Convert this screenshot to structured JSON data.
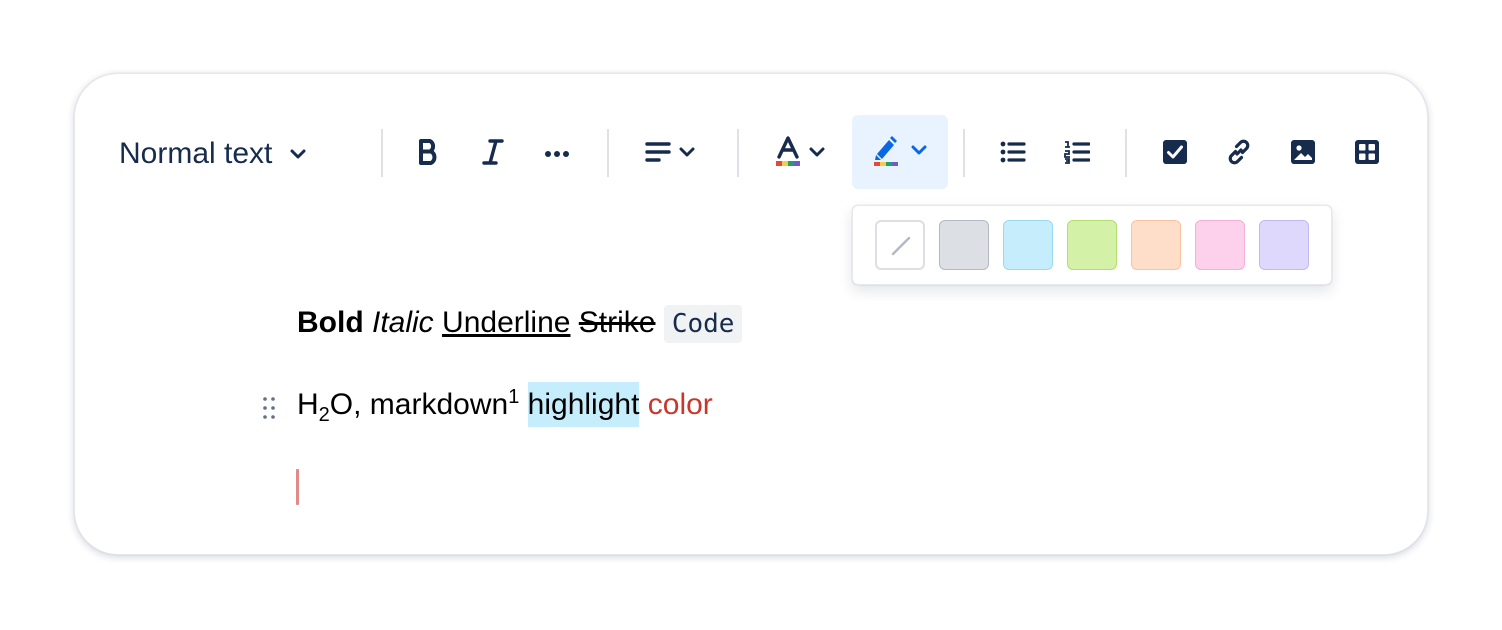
{
  "toolbar": {
    "text_style": {
      "label": "Normal text",
      "icon": "chevron-down-icon"
    },
    "buttons": [
      {
        "name": "bold",
        "icon": "bold-icon"
      },
      {
        "name": "italic",
        "icon": "italic-icon"
      },
      {
        "name": "more-formatting",
        "icon": "more-horizontal-icon"
      },
      {
        "name": "alignment",
        "icon": "align-left-icon"
      },
      {
        "name": "text-color",
        "icon": "text-color-icon"
      },
      {
        "name": "highlight",
        "icon": "highlighter-icon",
        "active": true
      },
      {
        "name": "bullet-list",
        "icon": "bullet-list-icon"
      },
      {
        "name": "numbered-list",
        "icon": "numbered-list-icon"
      },
      {
        "name": "task",
        "icon": "checkbox-icon"
      },
      {
        "name": "link",
        "icon": "link-icon"
      },
      {
        "name": "image",
        "icon": "image-icon"
      },
      {
        "name": "table",
        "icon": "table-icon"
      }
    ]
  },
  "highlight_palette": {
    "swatches": [
      {
        "name": "none",
        "color": "#ffffff"
      },
      {
        "name": "gray",
        "color": "#dcdfe4"
      },
      {
        "name": "blue",
        "color": "#c6edfb"
      },
      {
        "name": "green",
        "color": "#d3f1a7"
      },
      {
        "name": "orange",
        "color": "#fedec8"
      },
      {
        "name": "pink",
        "color": "#fdd0ec"
      },
      {
        "name": "purple",
        "color": "#dfd8fd"
      }
    ]
  },
  "content": {
    "line1": {
      "bold": "Bold",
      "italic": "Italic",
      "underline": "Underline",
      "strike": "Strike",
      "code": "Code"
    },
    "line2": {
      "h": "H",
      "sub": "2",
      "o": "O, markdown",
      "sup": "1",
      "highlight": "highlight",
      "color": "color"
    }
  },
  "colors": {
    "accent": "#0c66e4",
    "text": "#172b4d",
    "highlight_bg": "#c6edfb",
    "red_text": "#c9372c",
    "caret": "#e2898a"
  }
}
